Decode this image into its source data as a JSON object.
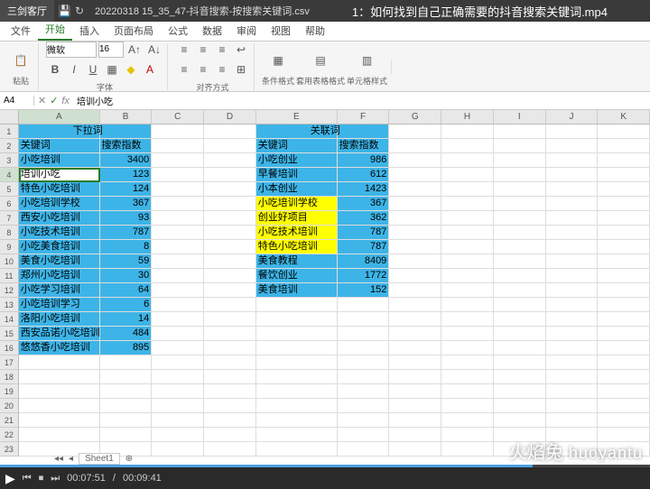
{
  "window": {
    "app_name": "三剑客厅",
    "file_tab": "20220318 15_35_47-抖音搜索-按搜索关键词.csv",
    "video_name": "1：如何找到自己正确需要的抖音搜索关键词.mp4"
  },
  "tabs": [
    "文件",
    "开始",
    "插入",
    "页面布局",
    "公式",
    "数据",
    "审阅",
    "视图",
    "帮助"
  ],
  "active_tab": 1,
  "ribbon": {
    "font_name": "微软",
    "font_size": "16",
    "section_font": "字体",
    "section_align": "对齐方式",
    "btn_paste": "粘贴",
    "btn_merge": "合并居中",
    "btn_format": "条件格式",
    "btn_table": "套用表格格式",
    "btn_cell_style": "单元格样式"
  },
  "name_box": {
    "cell": "A4",
    "formula": "培训小吃"
  },
  "columns": [
    "A",
    "B",
    "C",
    "D",
    "E",
    "F",
    "G",
    "H",
    "I",
    "J",
    "K"
  ],
  "table1": {
    "title": "下拉词",
    "h_key": "关键词",
    "h_idx": "搜索指数",
    "rows": [
      {
        "k": "小吃培训",
        "v": "3400"
      },
      {
        "k": "培训小吃",
        "v": "123",
        "active": true
      },
      {
        "k": "特色小吃培训",
        "v": "124"
      },
      {
        "k": "小吃培训学校",
        "v": "367"
      },
      {
        "k": "西安小吃培训",
        "v": "93"
      },
      {
        "k": "小吃技术培训",
        "v": "787"
      },
      {
        "k": "小吃美食培训",
        "v": "8"
      },
      {
        "k": "美食小吃培训",
        "v": "59"
      },
      {
        "k": "郑州小吃培训",
        "v": "30"
      },
      {
        "k": "小吃学习培训",
        "v": "64"
      },
      {
        "k": "小吃培训学习",
        "v": "6"
      },
      {
        "k": "洛阳小吃培训",
        "v": "14"
      },
      {
        "k": "西安品诺小吃培训",
        "v": "484"
      },
      {
        "k": "悠悠香小吃培训",
        "v": "895"
      }
    ]
  },
  "table2": {
    "title": "关联词",
    "h_key": "关键词",
    "h_idx": "搜索指数",
    "rows": [
      {
        "k": "小吃创业",
        "v": "986"
      },
      {
        "k": "早餐培训",
        "v": "612"
      },
      {
        "k": "小本创业",
        "v": "1423"
      },
      {
        "k": "小吃培训学校",
        "v": "367",
        "hl": true
      },
      {
        "k": "创业好项目",
        "v": "362",
        "hl": true
      },
      {
        "k": "小吃技术培训",
        "v": "787",
        "hl": true
      },
      {
        "k": "特色小吃培训",
        "v": "787",
        "hl": true
      },
      {
        "k": "美食教程",
        "v": "8409"
      },
      {
        "k": "餐饮创业",
        "v": "1772"
      },
      {
        "k": "美食培训",
        "v": "152"
      }
    ]
  },
  "sheet_tab": "Sheet1",
  "playback": {
    "current": "00:07:51",
    "total": "00:09:41"
  },
  "watermark": {
    "cn": "火焰兔",
    "en": "huoyantu"
  }
}
